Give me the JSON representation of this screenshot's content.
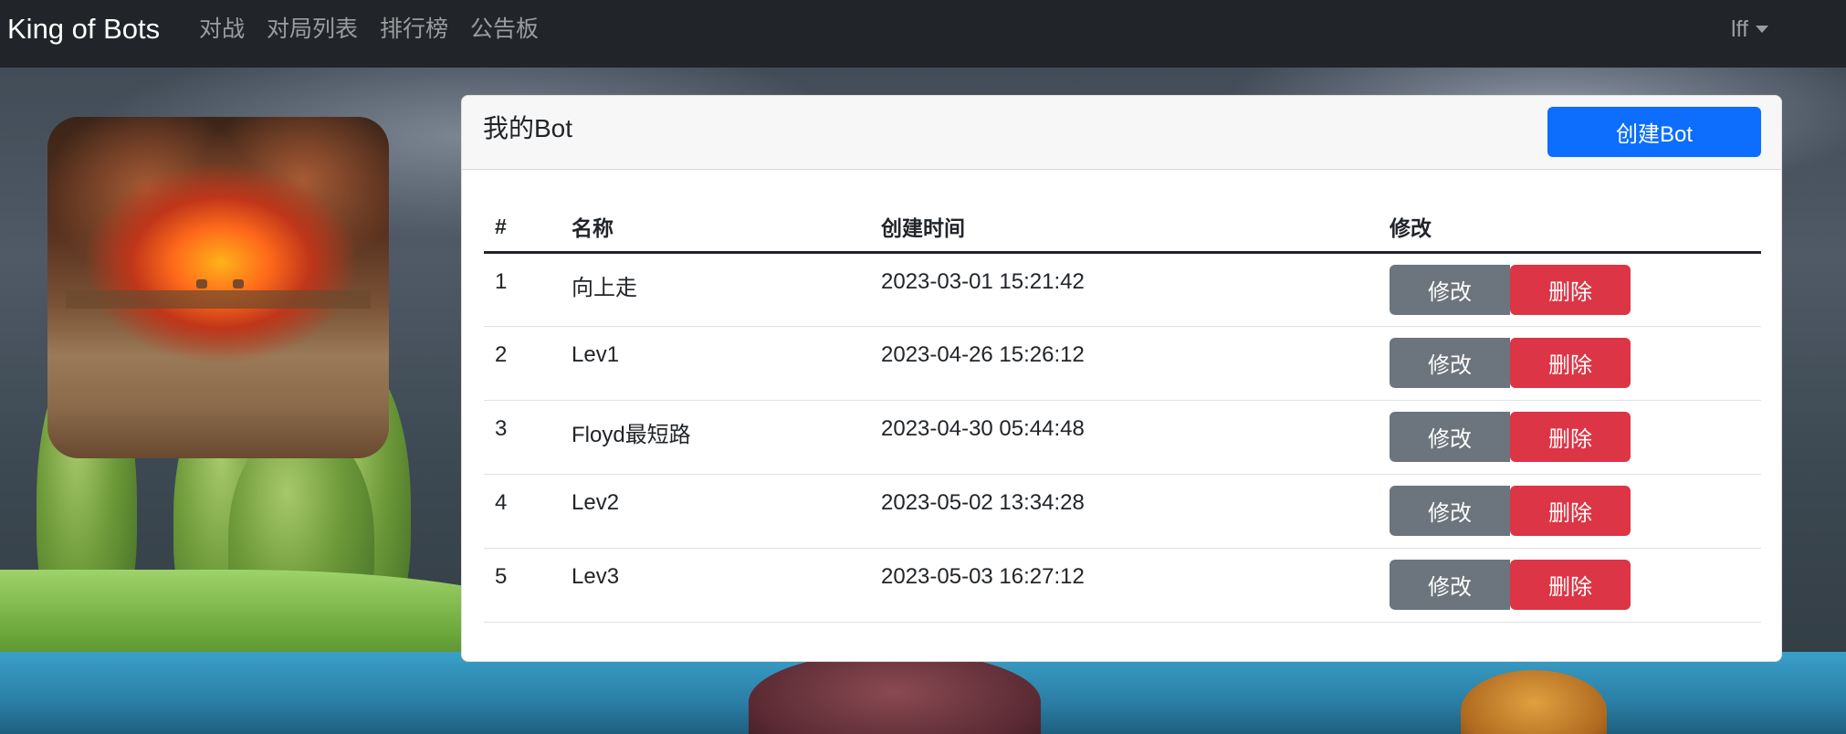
{
  "navbar": {
    "brand": "King of Bots",
    "links": [
      "对战",
      "对局列表",
      "排行榜",
      "公告板"
    ],
    "user": "lff"
  },
  "card": {
    "title": "我的Bot",
    "create_label": "创建Bot",
    "columns": [
      "#",
      "名称",
      "创建时间",
      "修改"
    ],
    "rows": [
      {
        "idx": "1",
        "name": "向上走",
        "time": "2023-03-01 15:21:42",
        "edit": "修改",
        "delete": "删除"
      },
      {
        "idx": "2",
        "name": "Lev1",
        "time": "2023-04-26 15:26:12",
        "edit": "修改",
        "delete": "删除"
      },
      {
        "idx": "3",
        "name": "Floyd最短路",
        "time": "2023-04-30 05:44:48",
        "edit": "修改",
        "delete": "删除"
      },
      {
        "idx": "4",
        "name": "Lev2",
        "time": "2023-05-02 13:34:28",
        "edit": "修改",
        "delete": "删除"
      },
      {
        "idx": "5",
        "name": "Lev3",
        "time": "2023-05-03 16:27:12",
        "edit": "修改",
        "delete": "删除"
      }
    ]
  },
  "colors": {
    "navbar_bg": "#212529",
    "primary": "#0d6efd",
    "secondary": "#6c757d",
    "danger": "#dc3545"
  },
  "icons": {
    "user_menu": "caret-down-icon"
  }
}
